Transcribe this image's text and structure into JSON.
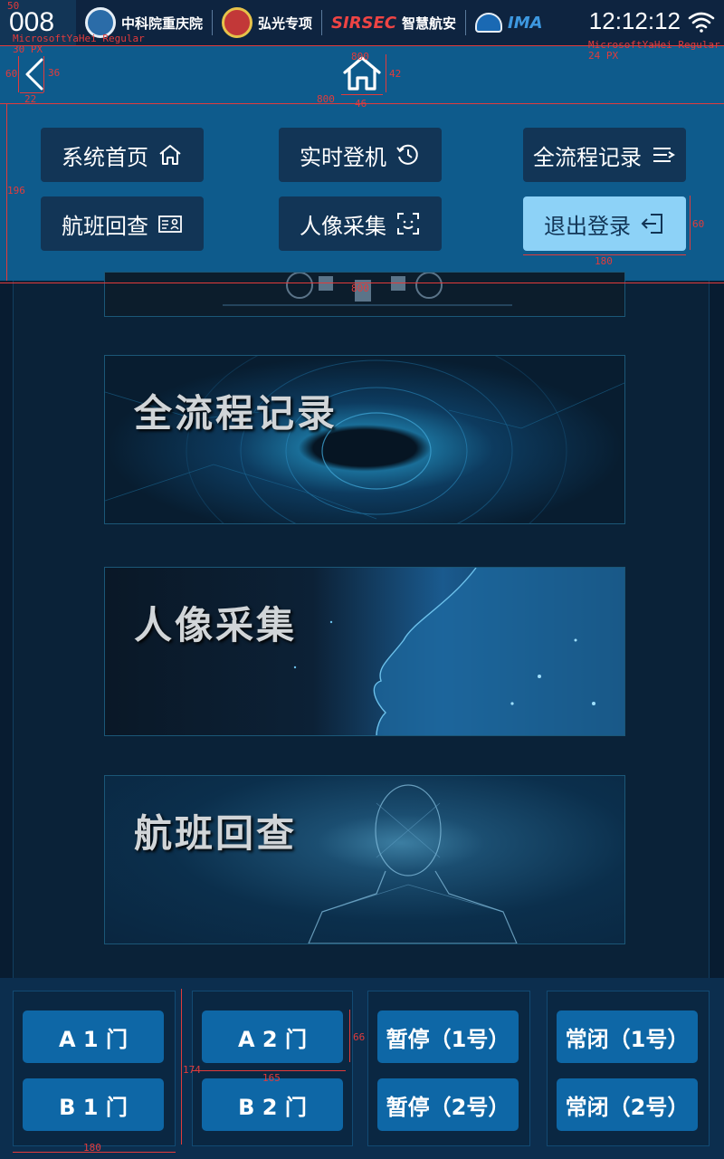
{
  "status_bar": {
    "station": "008",
    "logos": [
      {
        "name": "logo-cas-chongqing",
        "label": "中科院重庆院"
      },
      {
        "name": "logo-hongguang",
        "label": "弘光专项"
      },
      {
        "name": "logo-sirsec",
        "brand": "SIRSEC",
        "label": "智慧航安"
      },
      {
        "name": "logo-ima",
        "label": "IMA"
      }
    ],
    "clock": "12:12:12"
  },
  "menu": {
    "buttons": [
      {
        "label": "系统首页",
        "icon": "home-icon"
      },
      {
        "label": "实时登机",
        "icon": "history-icon"
      },
      {
        "label": "全流程记录",
        "icon": "list-icon"
      },
      {
        "label": "航班回查",
        "icon": "id-card-icon"
      },
      {
        "label": "人像采集",
        "icon": "face-scan-icon"
      },
      {
        "label": "退出登录",
        "icon": "logout-icon"
      }
    ],
    "active_label": "退出登录"
  },
  "cards": [
    {
      "title": "全流程记录"
    },
    {
      "title": "人像采集"
    },
    {
      "title": "航班回查"
    }
  ],
  "doors": [
    {
      "top": "A 1 门",
      "bottom": "B 1 门"
    },
    {
      "top": "A 2 门",
      "bottom": "B 2 门"
    },
    {
      "top": "暂停（1号）",
      "bottom": "暂停（2号）"
    },
    {
      "top": "常闭（1号）",
      "bottom": "常闭（2号）"
    }
  ],
  "annotations": {
    "status_height": "50",
    "font_left": "MicrosoftYaHei Regular",
    "font_left_size": "30 PX",
    "font_right": "MicrosoftYaHei Regular",
    "font_right_size": "24 PX",
    "back_60": "60",
    "back_36": "36",
    "back_22": "22",
    "home_800_top": "800",
    "home_42": "42",
    "home_800_left": "800",
    "home_46": "46",
    "menu_196": "196",
    "menu_800": "800",
    "btn_60": "60",
    "btn_180": "180",
    "door_66": "66",
    "door_174": "174",
    "door_165": "165",
    "door_180": "180"
  },
  "colors": {
    "accent": "#0e5b8c",
    "active_button": "#8dd2f7",
    "door_button": "#0e67a6",
    "annotation": "#e23b3b"
  }
}
